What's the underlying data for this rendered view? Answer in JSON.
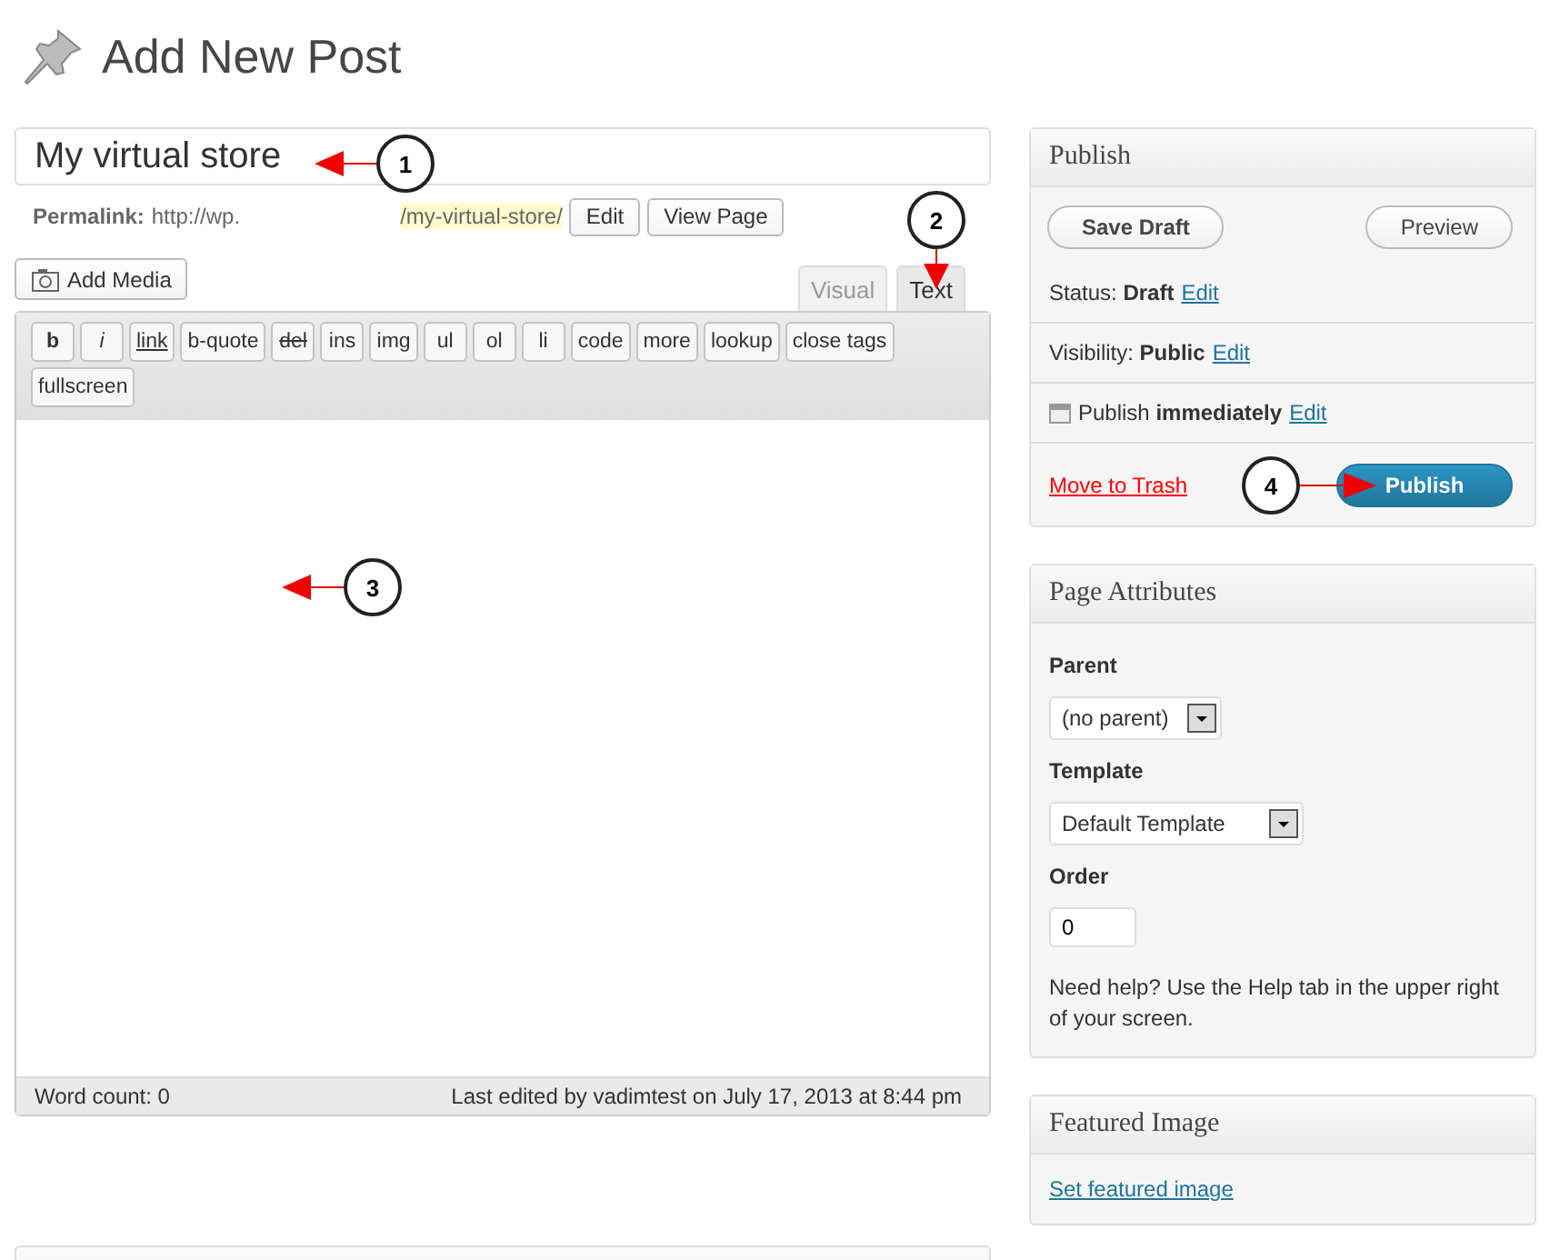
{
  "page_title": "Add New Post",
  "post_title": "My virtual store",
  "permalink": {
    "label": "Permalink:",
    "base": "http://wp.",
    "slug": "/my-virtual-store/",
    "buttons": [
      "Edit",
      "View Page"
    ]
  },
  "add_media": "Add Media",
  "editor_tabs": [
    {
      "label": "Visual",
      "selected": false
    },
    {
      "label": "Text",
      "selected": true
    }
  ],
  "toolbar": [
    {
      "label": "b",
      "kind": "bold"
    },
    {
      "label": "i",
      "kind": "italic"
    },
    {
      "label": "link",
      "kind": "underline"
    },
    {
      "label": "b-quote",
      "kind": "plain"
    },
    {
      "label": "del",
      "kind": "strike"
    },
    {
      "label": "ins",
      "kind": "plain"
    },
    {
      "label": "img",
      "kind": "plain"
    },
    {
      "label": "ul",
      "kind": "plain"
    },
    {
      "label": "ol",
      "kind": "plain"
    },
    {
      "label": "li",
      "kind": "plain"
    },
    {
      "label": "code",
      "kind": "plain"
    },
    {
      "label": "more",
      "kind": "plain"
    },
    {
      "label": "lookup",
      "kind": "plain"
    },
    {
      "label": "close tags",
      "kind": "plain"
    },
    {
      "label": "fullscreen",
      "kind": "plain"
    }
  ],
  "footer": {
    "word_count": "Word count: 0",
    "last_edited": "Last edited by vadimtest on July 17, 2013 at 8:44 pm"
  },
  "publish": {
    "title": "Publish",
    "save_draft": "Save Draft",
    "preview": "Preview",
    "rows": [
      {
        "text": "Status: **Draft**",
        "link": "Edit",
        "kind": "plain"
      },
      {
        "text": "Visibility: **Public**",
        "link": "Edit",
        "kind": "plain"
      },
      {
        "text": "Publish **immediately**",
        "link": "Edit",
        "kind": "calendar"
      }
    ],
    "trash": "Move to Trash",
    "publish_button": "Publish"
  },
  "page_attributes": {
    "title": "Page Attributes",
    "parent_label": "Parent",
    "parent_value": "(no parent)",
    "template_label": "Template",
    "template_value": "Default Template",
    "order_label": "Order",
    "order_value": "0",
    "help": "Need help? Use the Help tab in the upper right of your screen."
  },
  "featured_image": {
    "title": "Featured Image",
    "link": "Set featured image"
  },
  "callouts": [
    {
      "label": "1"
    },
    {
      "label": "2"
    },
    {
      "label": "3"
    },
    {
      "label": "4"
    }
  ]
}
